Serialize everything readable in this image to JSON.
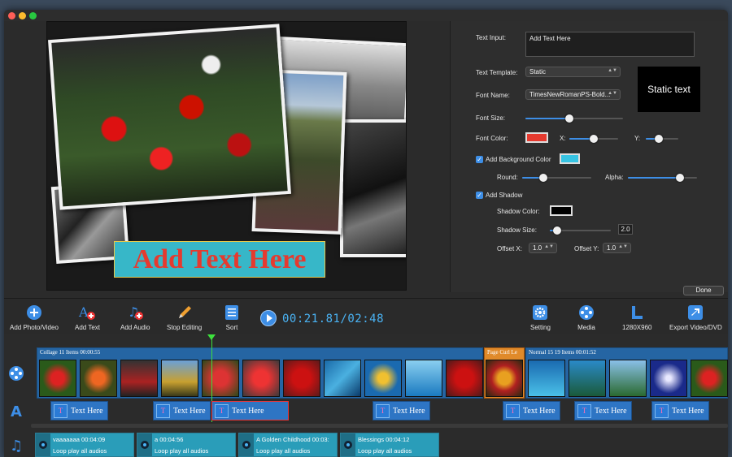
{
  "preview": {
    "overlay_text": "Add Text Here"
  },
  "panel": {
    "text_input_label": "Text Input:",
    "text_input_value": "Add Text Here",
    "template_label": "Text Template:",
    "template_value": "Static",
    "font_name_label": "Font Name:",
    "font_name_value": "TimesNewRomanPS-Bold...",
    "font_size_label": "Font Size:",
    "font_size_level": 0.45,
    "font_color_label": "Font Color:",
    "font_color": "#e53a2f",
    "x_label": "X:",
    "x_level": 0.5,
    "y_label": "Y:",
    "y_level": 0.4,
    "bg_color_label": "Add Background Color",
    "bg_color": "#37c4e3",
    "round_label": "Round:",
    "round_level": 0.3,
    "alpha_label": "Alpha:",
    "alpha_level": 0.75,
    "shadow_label": "Add Shadow",
    "shadow_color_label": "Shadow Color:",
    "shadow_color": "#000000",
    "shadow_size_label": "Shadow Size:",
    "shadow_size_value": "2.0",
    "shadow_size_level": 0.12,
    "offset_x_label": "Offset X:",
    "offset_x_value": "1.0",
    "offset_y_label": "Offset Y:",
    "offset_y_value": "1.0",
    "preview_text": "Static text",
    "done_label": "Done"
  },
  "toolbar": {
    "add_photo": "Add Photo/Video",
    "add_text": "Add Text",
    "add_audio": "Add Audio",
    "stop_editing": "Stop Editing",
    "sort": "Sort",
    "time": "00:21.81/02:48",
    "setting": "Setting",
    "media": "Media",
    "resolution": "1280X960",
    "export": "Export Video/DVD"
  },
  "timeline": {
    "group1_header": "Collage   11 Items   00:00:55",
    "group2_header": "Page Curl Le",
    "group3_header": "Normal 15   19 Items   00:01:52",
    "text_clip_label": "Text Here",
    "audio": [
      {
        "title": "vaaaaaaa  00:04:09",
        "mode": "Loop play all audios"
      },
      {
        "title": "a  00:04:56",
        "mode": "Loop play all audios"
      },
      {
        "title": "A Golden Childhood  00:03:",
        "mode": "Loop play all audios"
      },
      {
        "title": "Blessings  00:04:12",
        "mode": "Loop play all audios"
      }
    ]
  }
}
